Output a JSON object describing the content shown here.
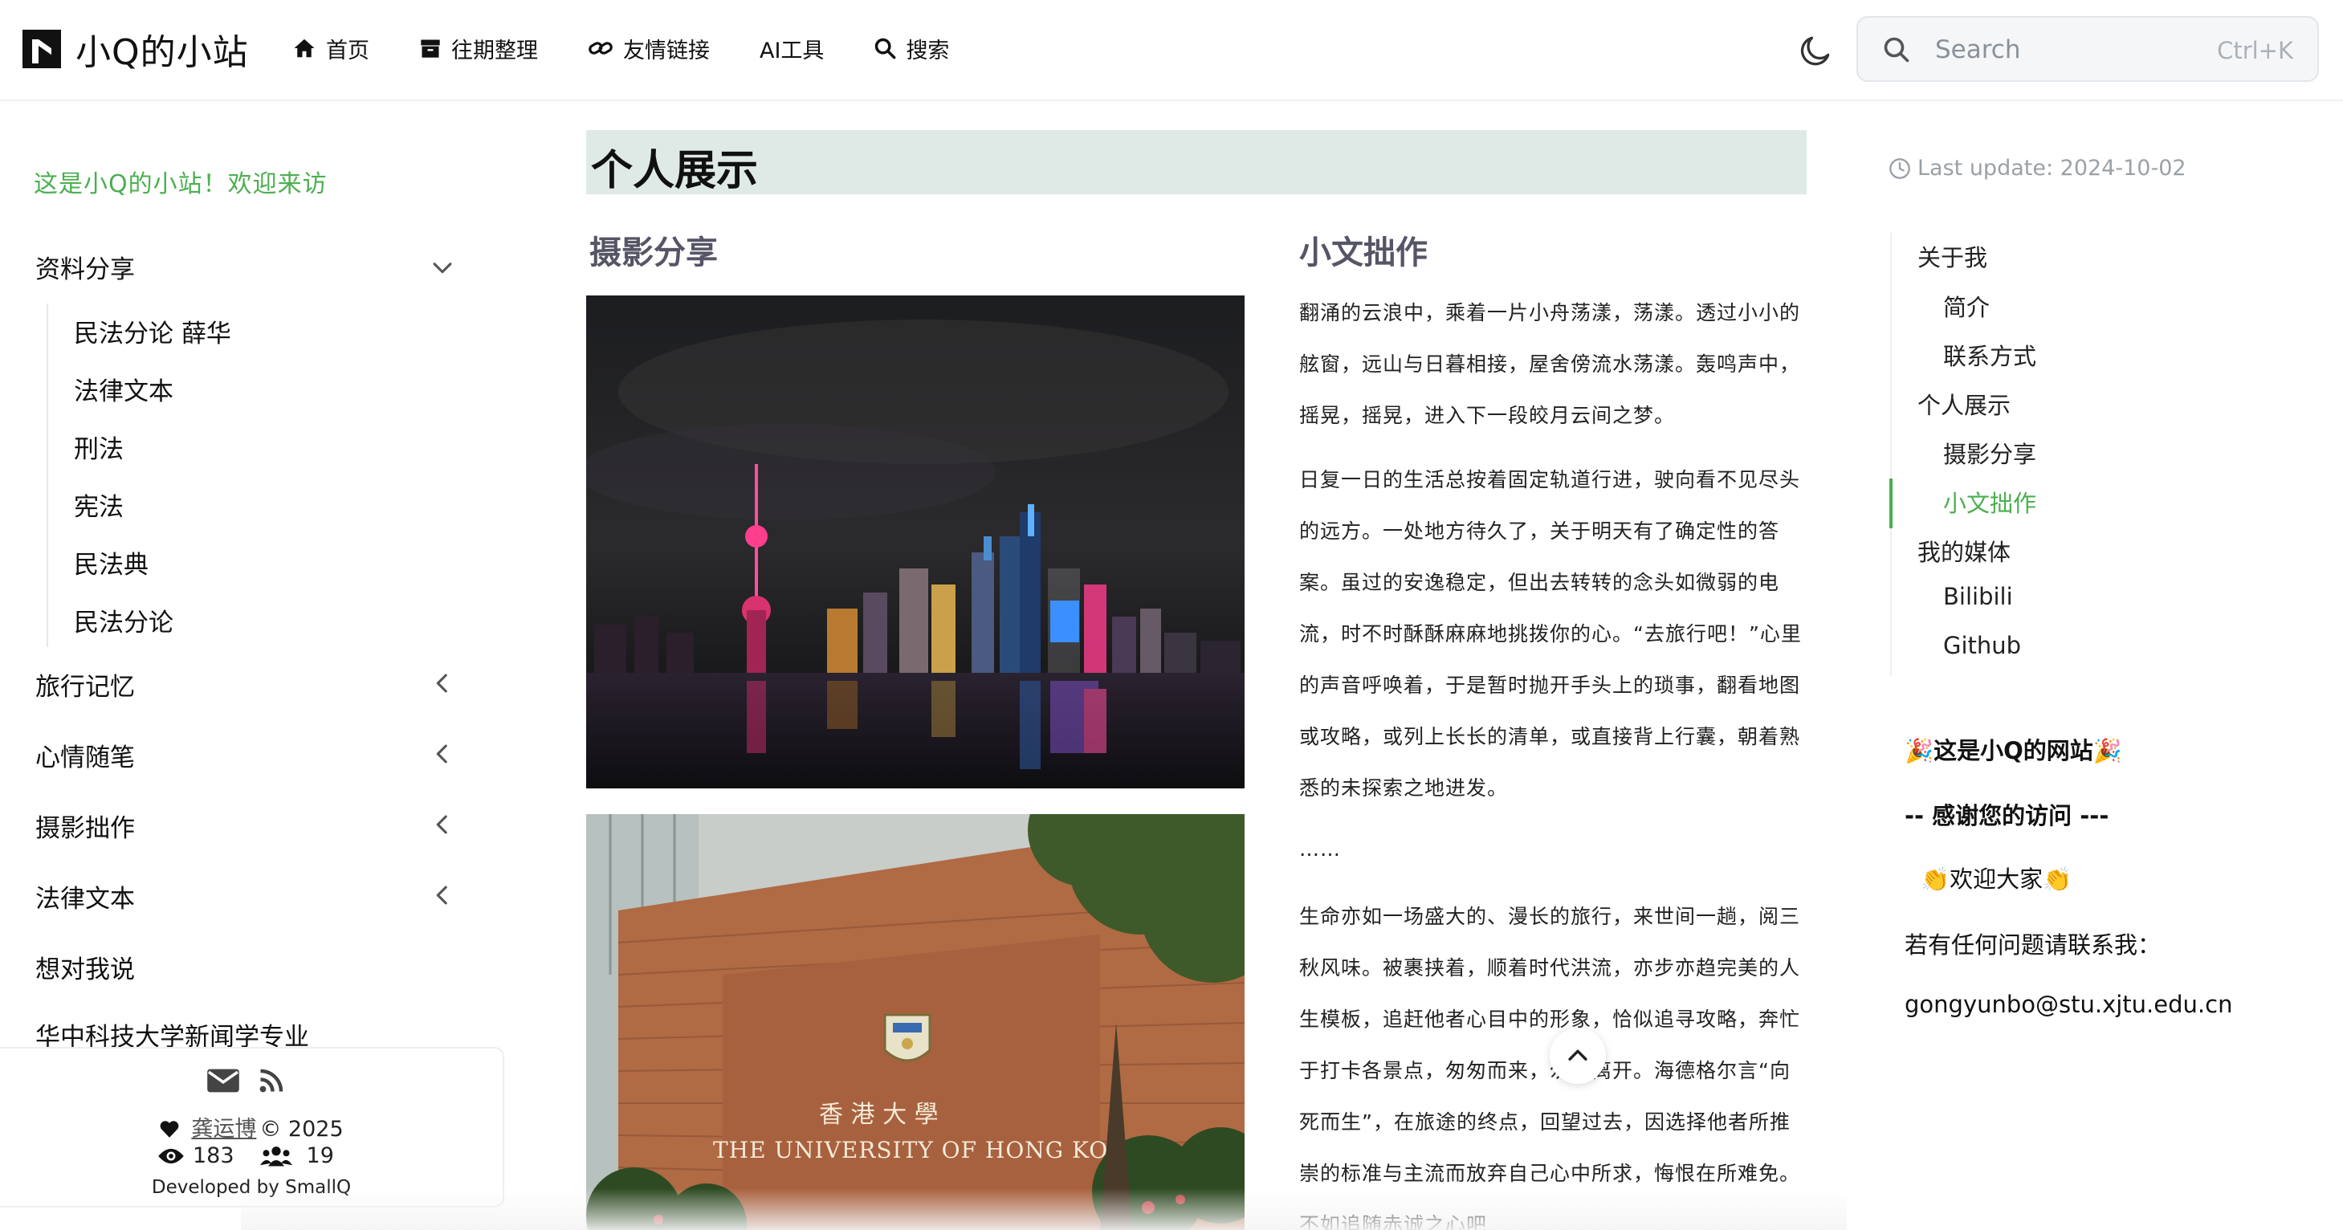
{
  "navbar": {
    "site_title": "小Q的小站",
    "links": [
      "首页",
      "往期整理",
      "友情链接",
      "AI工具",
      "搜索"
    ],
    "search": {
      "placeholder": "Search",
      "shortcut": "Ctrl+K"
    }
  },
  "sidebar": {
    "welcome": "这是小Q的小站！欢迎来访",
    "section_1": "资料分享",
    "section_1_children": [
      "民法分论 薛华",
      "法律文本",
      "刑法",
      "宪法",
      "民法典",
      "民法分论"
    ],
    "section_2": "旅行记忆",
    "section_3": "心情随笔",
    "section_4": "摄影拙作",
    "section_5": "法律文本",
    "item_6": "想对我说",
    "item_7": "华中科技大学新闻学专业",
    "footer": {
      "author": "龚运博",
      "copyright": "© 2025",
      "views": "183",
      "visitors": "19",
      "developed_by": "Developed by SmallQ"
    }
  },
  "main": {
    "title": "个人展示",
    "photo_heading": "摄影分享",
    "essay_heading": "小文拙作",
    "paragraphs": [
      "翻涌的云浪中，乘着一片小舟荡漾，荡漾。透过小小的舷窗，远山与日暮相接，屋舍傍流水荡漾。轰鸣声中，摇晃，摇晃，进入下一段皎月云间之梦。",
      "日复一日的生活总按着固定轨道行进，驶向看不见尽头的远方。一处地方待久了，关于明天有了确定性的答案。虽过的安逸稳定，但出去转转的念头如微弱的电流，时不时酥酥麻麻地挑拨你的心。“去旅行吧！”心里的声音呼唤着，于是暂时抛开手头上的琐事，翻看地图或攻略，或列上长长的清单，或直接背上行囊，朝着熟悉的未探索之地进发。",
      "……",
      "生命亦如一场盛大的、漫长的旅行，来世间一趟，阅三秋风味。被裹挟着，顺着时代洪流，亦步亦趋完美的人生模板，追赶他者心目中的形象，恰似追寻攻略，奔忙于打卡各景点，匆匆而来，匆匆离开。海德格尔言“向死而生”，在旅途的终点，回望过去，因选择他者所推崇的标准与主流而放弃自己心中所求，悔恨在所难免。不如追随赤诚之心吧"
    ],
    "photo_2_sign_cn": "香 港 大 學",
    "photo_2_sign_en": "THE UNIVERSITY OF HONG KONG"
  },
  "toc": {
    "last_update": "Last update: 2024-10-02",
    "items": [
      "关于我",
      "简介",
      "联系方式",
      "个人展示",
      "摄影分享",
      "小文拙作",
      "我的媒体",
      "Bilibili",
      "Github"
    ]
  },
  "side_notes": {
    "line_1": "🎉这是小Q的网站🎉",
    "line_2": "-- 感谢您的访问 ---",
    "line_3": "👏欢迎大家👏",
    "line_4": "若有任何问题请联系我：",
    "line_5": "gongyunbo@stu.xjtu.edu.cn"
  },
  "colors": {
    "accent_green": "#4caf50",
    "title_bar": "#dfeae6"
  },
  "icons": [
    "logo-icon",
    "home-icon",
    "archive-icon",
    "link-icon",
    "search-icon",
    "moon-icon",
    "chevron-down-icon",
    "chevron-left-icon",
    "mail-icon",
    "rss-icon",
    "heart-icon",
    "eye-icon",
    "users-icon",
    "clock-icon",
    "chevron-up-icon"
  ]
}
